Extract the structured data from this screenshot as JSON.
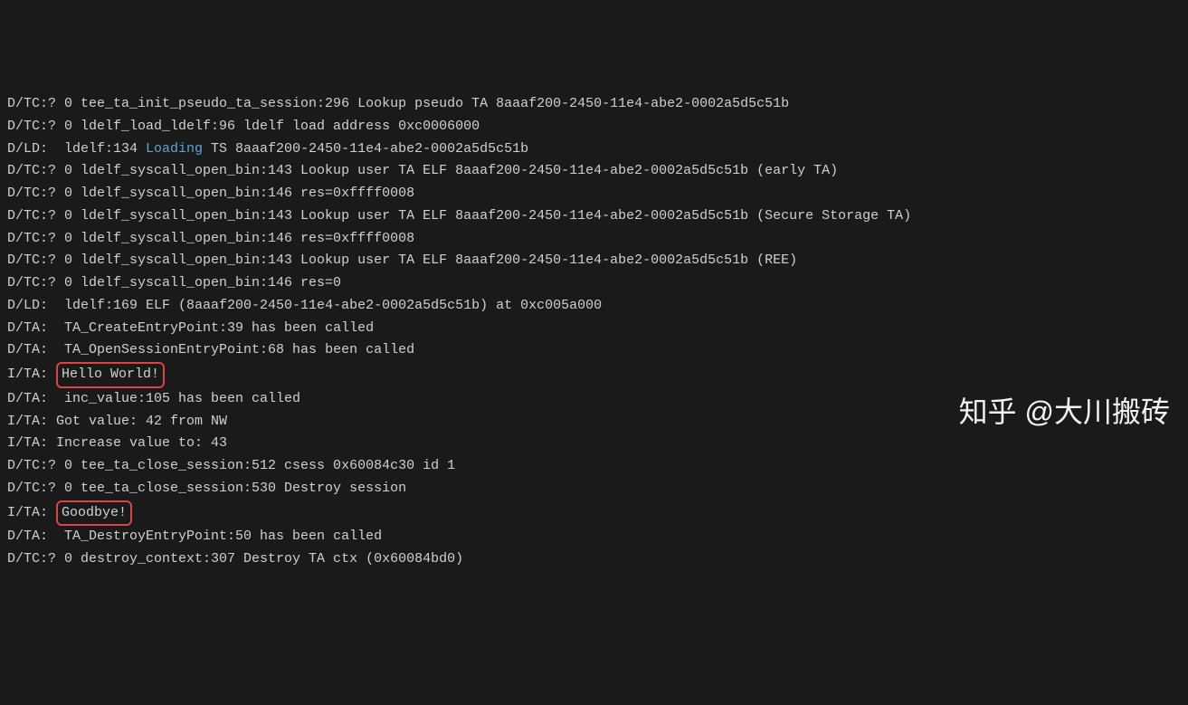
{
  "lines": [
    {
      "prefix": "D/TC:? 0 ",
      "text": "tee_ta_init_pseudo_ta_session:296 Lookup pseudo TA 8aaaf200-2450-11e4-abe2-0002a5d5c51b"
    },
    {
      "prefix": "D/TC:? 0 ",
      "text": "ldelf_load_ldelf:96 ldelf load address 0xc0006000"
    },
    {
      "prefix": "D/LD:  ",
      "pre": "ldelf:134 ",
      "hl": "Loading",
      "post": " TS 8aaaf200-2450-11e4-abe2-0002a5d5c51b"
    },
    {
      "prefix": "D/TC:? 0 ",
      "text": "ldelf_syscall_open_bin:143 Lookup user TA ELF 8aaaf200-2450-11e4-abe2-0002a5d5c51b (early TA)"
    },
    {
      "prefix": "D/TC:? 0 ",
      "text": "ldelf_syscall_open_bin:146 res=0xffff0008"
    },
    {
      "prefix": "D/TC:? 0 ",
      "text": "ldelf_syscall_open_bin:143 Lookup user TA ELF 8aaaf200-2450-11e4-abe2-0002a5d5c51b (Secure Storage TA)"
    },
    {
      "prefix": "D/TC:? 0 ",
      "text": "ldelf_syscall_open_bin:146 res=0xffff0008"
    },
    {
      "prefix": "D/TC:? 0 ",
      "text": "ldelf_syscall_open_bin:143 Lookup user TA ELF 8aaaf200-2450-11e4-abe2-0002a5d5c51b (REE)"
    },
    {
      "prefix": "D/TC:? 0 ",
      "text": "ldelf_syscall_open_bin:146 res=0"
    },
    {
      "prefix": "D/LD:  ",
      "text": "ldelf:169 ELF (8aaaf200-2450-11e4-abe2-0002a5d5c51b) at 0xc005a000"
    },
    {
      "prefix": "D/TA:  ",
      "text": "TA_CreateEntryPoint:39 has been called"
    },
    {
      "prefix": "D/TA:  ",
      "text": "TA_OpenSessionEntryPoint:68 has been called"
    },
    {
      "prefix": "I/TA: ",
      "boxed": "Hello World!"
    },
    {
      "prefix": "D/TA:  ",
      "text": "inc_value:105 has been called"
    },
    {
      "prefix": "I/TA: ",
      "text": "Got value: 42 from NW"
    },
    {
      "prefix": "I/TA: ",
      "text": "Increase value to: 43"
    },
    {
      "prefix": "D/TC:? 0 ",
      "text": "tee_ta_close_session:512 csess 0x60084c30 id 1"
    },
    {
      "prefix": "D/TC:? 0 ",
      "text": "tee_ta_close_session:530 Destroy session"
    },
    {
      "prefix": "I/TA: ",
      "boxed": "Goodbye!"
    },
    {
      "prefix": "D/TA:  ",
      "text": "TA_DestroyEntryPoint:50 has been called"
    },
    {
      "prefix": "D/TC:? 0 ",
      "text": "destroy_context:307 Destroy TA ctx (0x60084bd0)"
    }
  ],
  "watermark": "知乎 @大川搬砖"
}
